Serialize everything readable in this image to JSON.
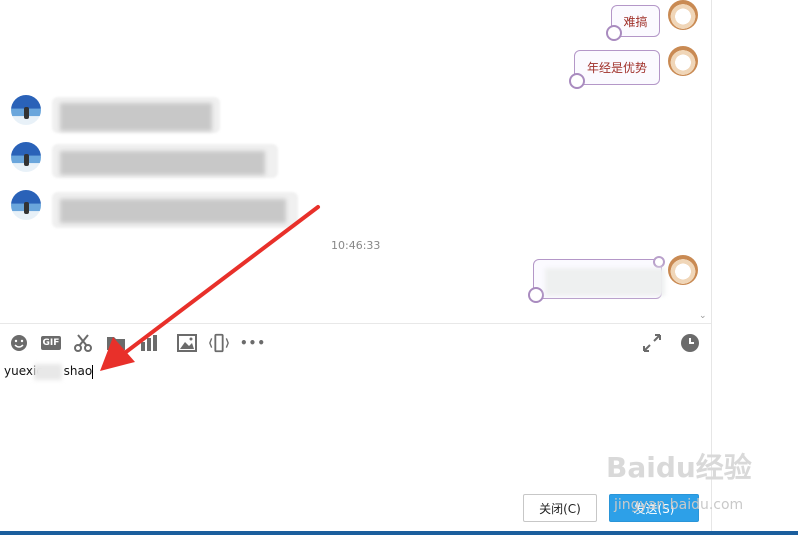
{
  "messages": {
    "self_1": "难搞",
    "self_2": "年经是优势",
    "timestamp": "10:46:33"
  },
  "toolbar": {
    "emoji_icon": "smiley-icon",
    "gif_label": "GIF",
    "scissors_icon": "scissors-icon",
    "folder_icon": "folder-icon",
    "chart_icon": "chart-icon",
    "image_icon": "image-icon",
    "shake_icon": "phone-shake-icon",
    "more_label": "•••",
    "expand_icon": "expand-icon",
    "history_icon": "clock-icon"
  },
  "input": {
    "prefix": "yuexio",
    "suffix": "shao"
  },
  "buttons": {
    "close_label": "关闭(C)",
    "send_label": "发送(S)"
  },
  "watermark": {
    "text": "Baidu经验",
    "sub": "jingyan.baidu.com"
  },
  "colors": {
    "send_button": "#2da0e8",
    "arrow": "#e8302a",
    "bubble_border": "#b497c8"
  }
}
